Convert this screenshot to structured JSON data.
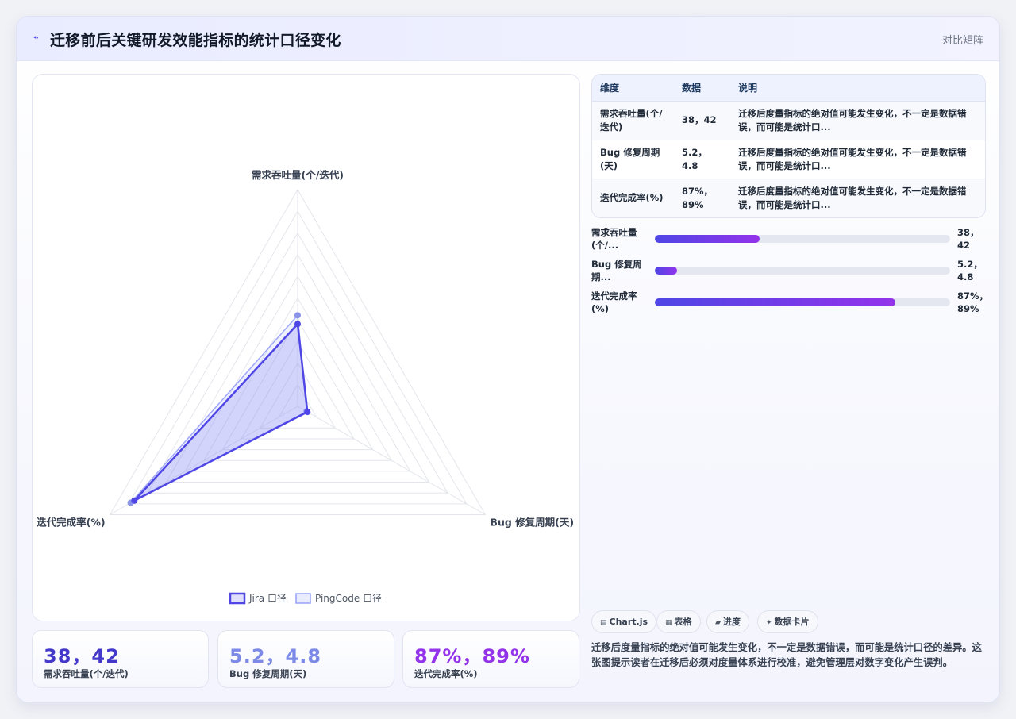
{
  "header": {
    "title": "迁移前后关键研发效能指标的统计口径变化",
    "subtitle": "对比矩阵",
    "icon": "chart-line-icon"
  },
  "colors": {
    "accent": "#4f46e5",
    "series2": "#8b93e8",
    "purple": "#9333ea"
  },
  "chart_data": {
    "type": "radar",
    "axes": [
      "需求吞吐量(个/迭代)",
      "Bug 修复周期(天)",
      "迭代完成率(%)"
    ],
    "series": [
      {
        "name": "Jira 口径",
        "values": [
          38,
          5.2,
          87
        ]
      },
      {
        "name": "PingCode 口径",
        "values": [
          42,
          4.8,
          89
        ]
      }
    ],
    "axis_max": [
      100,
      100,
      100
    ],
    "grid_levels": 10,
    "legend_position": "bottom"
  },
  "kpis": [
    {
      "value": "38，42",
      "label": "需求吞吐量(个/迭代)",
      "color": "#4338ca"
    },
    {
      "value": "5.2，4.8",
      "label": "Bug 修复周期(天)",
      "color": "#7c8ae6"
    },
    {
      "value": "87%，89%",
      "label": "迭代完成率(%)",
      "color": "#9333ea"
    }
  ],
  "table": {
    "headers": [
      "维度",
      "数据",
      "说明"
    ],
    "rows": [
      {
        "dim": "需求吞吐量(个/迭代)",
        "data": "38，42",
        "desc": "迁移后度量指标的绝对值可能发生变化，不一定是数据错误，而可能是统计口..."
      },
      {
        "dim": "Bug 修复周期(天)",
        "data": "5.2，4.8",
        "desc": "迁移后度量指标的绝对值可能发生变化，不一定是数据错误，而可能是统计口..."
      },
      {
        "dim": "迭代完成率(%)",
        "data": "87%，89%",
        "desc": "迁移后度量指标的绝对值可能发生变化，不一定是数据错误，而可能是统计口..."
      }
    ]
  },
  "bars": [
    {
      "label": "需求吞吐量(个/...",
      "value": "38，42",
      "fraction": 0.355
    },
    {
      "label": "Bug 修复周期...",
      "value": "5.2，4.8",
      "fraction": 0.075
    },
    {
      "label": "迭代完成率(%)",
      "value": "87%，89%",
      "fraction": 0.815
    }
  ],
  "chips": [
    {
      "icon": "▤",
      "label": "Chart.js"
    },
    {
      "icon": "▦",
      "label": "表格"
    },
    {
      "icon": "▰",
      "label": "进度"
    },
    {
      "icon": "✦",
      "label": "数据卡片"
    }
  ],
  "note": "迁移后度量指标的绝对值可能发生变化，不一定是数据错误，而可能是统计口径的差异。这张图提示读者在迁移后必须对度量体系进行校准，避免管理层对数字变化产生误判。"
}
